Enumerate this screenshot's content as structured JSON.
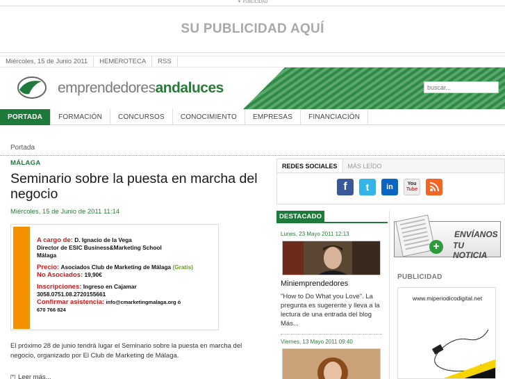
{
  "ad_top": {
    "tag": "PUBLICIDAD",
    "banner_text": "SU PUBLICIDAD AQUÍ"
  },
  "topbar": {
    "date": "Miércoles, 15 de Junio 2011",
    "links": [
      "HEMEROTECA",
      "RSS"
    ]
  },
  "header": {
    "logo_light": "emprendedores",
    "logo_bold": "andaluces",
    "search_placeholder": "buscar..."
  },
  "nav": {
    "items": [
      "PORTADA",
      "FORMACIÓN",
      "CONCURSOS",
      "CONOCIMIENTO",
      "EMPRESAS",
      "FINANCIACIÓN"
    ],
    "active": 0
  },
  "breadcrumb": "Portada",
  "article": {
    "section": "MÁLAGA",
    "title": "Seminario sobre la puesta en marcha del negocio",
    "date": "Miércoles, 15 de Junio de 2011 11:14",
    "poster": {
      "l1_red": "A cargo de:",
      "l1": "D. Ignacio de la Vega",
      "l2": "Director de ESIC Business&Marketing School",
      "l3": "Málaga",
      "l4_red": "Precio:",
      "l4": "Asociados Club de Marketing de Málaga",
      "l4_green": "(Gratis)",
      "l5_red": "No Asociados:",
      "l5": "19,90€",
      "l6_red": "Inscripciones:",
      "l6": "Ingreso en Cajamar",
      "l7": "3058.0751.08.2720155661",
      "l8_red": "Confirmar asistencia:",
      "l8": "info@cmarketingmalaga.org ó",
      "l9": "670 766 824"
    },
    "body": "El próximo 28 de junio tendrá lugar el Seminario sobre la puesta en marcha del negocio, organizado por El Club de Marketing de Málaga.",
    "read_more": "Leer más..."
  },
  "social": {
    "tabs": [
      "REDES SOCIALES",
      "MÁS LEÍDO"
    ],
    "icons": [
      "facebook-icon",
      "twitter-icon",
      "linkedin-icon",
      "youtube-icon",
      "rss-icon"
    ],
    "icon_glyphs": {
      "fb": "f",
      "tw": "t",
      "li": "in",
      "yt1": "You",
      "yt2": "Tube"
    }
  },
  "destacado": {
    "label": "DESTACADO",
    "posts": [
      {
        "date": "Lunes, 23 Mayo 2011 12:13",
        "title": "Miniemprendedores",
        "text": "\"How to Do What you Love\". La pregunta es sugerente y lleva a la lectura de una entrada del blog Más..."
      },
      {
        "date": "Viernes, 13 Mayo 2011 09:40"
      }
    ]
  },
  "promo": {
    "line1": "ENVÍANOS",
    "line2": "TU NOTICIA",
    "plus": "+"
  },
  "publicidad": {
    "label": "PUBLICIDAD",
    "url": "www.miperiodicodigital.net"
  },
  "colors": {
    "brand_green": "#1e7a3a",
    "poster_orange": "#f39100",
    "poster_red": "#d0181a"
  }
}
